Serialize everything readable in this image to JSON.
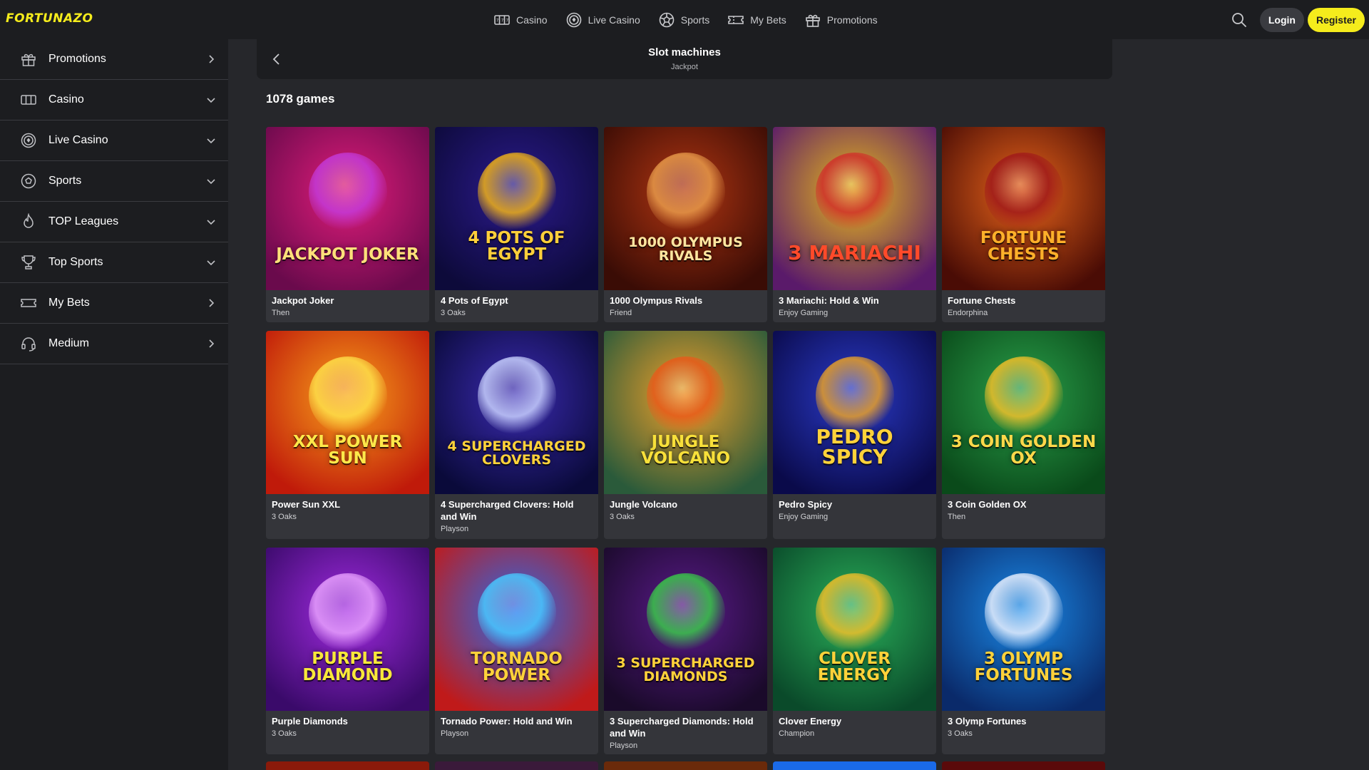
{
  "brand": {
    "logo": "FORTUNAZO",
    "accent": "#f5ec1c"
  },
  "topnav": [
    {
      "label": "Casino",
      "icon": "slot-machine-icon"
    },
    {
      "label": "Live Casino",
      "icon": "live-casino-chip-icon"
    },
    {
      "label": "Sports",
      "icon": "soccer-ball-icon"
    },
    {
      "label": "My Bets",
      "icon": "ticket-icon"
    },
    {
      "label": "Promotions",
      "icon": "gift-icon"
    }
  ],
  "actions": {
    "login": "Login",
    "register": "Register"
  },
  "sidebar": [
    {
      "label": "Promotions",
      "icon": "gift-icon",
      "chevron": "right"
    },
    {
      "label": "Casino",
      "icon": "slot-machine-icon",
      "chevron": "down"
    },
    {
      "label": "Live Casino",
      "icon": "live-casino-chip-icon",
      "chevron": "down"
    },
    {
      "label": "Sports",
      "icon": "soccer-ball-icon",
      "chevron": "down"
    },
    {
      "label": "TOP Leagues",
      "icon": "flame-icon",
      "chevron": "down"
    },
    {
      "label": "Top Sports",
      "icon": "trophy-icon",
      "chevron": "down"
    },
    {
      "label": "My Bets",
      "icon": "ticket-icon",
      "chevron": "right"
    },
    {
      "label": "Medium",
      "icon": "support-headset-icon",
      "chevron": "right"
    }
  ],
  "category": {
    "title": "Slot machines",
    "subtitle": "Jackpot"
  },
  "count": "1078 games",
  "games": [
    {
      "name": "Jackpot Joker",
      "provider": "Then",
      "art": "JACKPOT JOKER",
      "bg1": "#e01c7a",
      "bg2": "#6a0a4c",
      "orb": "#c43ad9",
      "txt": "#ffe07a"
    },
    {
      "name": "4 Pots of Egypt",
      "provider": "3 Oaks",
      "art": "4 POTS OF EGYPT",
      "bg1": "#2b1a8c",
      "bg2": "#0d0a3a",
      "orb": "#f0b21a",
      "txt": "#ffcf3a"
    },
    {
      "name": "1000 Olympus Rivals",
      "provider": "Friend",
      "art": "1000 OLYMPUS RIVALS",
      "bg1": "#b03512",
      "bg2": "#3a0c05",
      "orb": "#e89a4a",
      "txt": "#ffe6a0"
    },
    {
      "name": "3 Mariachi: Hold & Win",
      "provider": "Enjoy Gaming",
      "art": "3 MARIACHI",
      "bg1": "#e8b81a",
      "bg2": "#5a1a6a",
      "orb": "#d0302a",
      "txt": "#ff4a2a"
    },
    {
      "name": "Fortune Chests",
      "provider": "Endorphina",
      "art": "FORTUNE CHESTS",
      "bg1": "#e8641a",
      "bg2": "#4a0c05",
      "orb": "#a01a1a",
      "txt": "#ffb02a"
    },
    {
      "name": "Power Sun XXL",
      "provider": "3 Oaks",
      "art": "XXL POWER SUN",
      "bg1": "#f8a01a",
      "bg2": "#c01a0a",
      "orb": "#ffe04a",
      "txt": "#ffe84a"
    },
    {
      "name": "4 Supercharged Clovers: Hold and Win",
      "provider": "Playson",
      "art": "4 SUPERCHARGED CLOVERS",
      "bg1": "#3a2ab0",
      "bg2": "#0a0a3a",
      "orb": "#c8d0ff",
      "txt": "#ffd23a"
    },
    {
      "name": "Jungle Volcano",
      "provider": "3 Oaks",
      "art": "JUNGLE VOLCANO",
      "bg1": "#f0a02a",
      "bg2": "#2a5a3a",
      "orb": "#e85a1a",
      "txt": "#f8e03a"
    },
    {
      "name": "Pedro Spicy",
      "provider": "Enjoy Gaming",
      "art": "PEDRO SPICY",
      "bg1": "#2a3ac8",
      "bg2": "#0a0a4a",
      "orb": "#e8a02a",
      "txt": "#ffd23a"
    },
    {
      "name": "3 Coin Golden OX",
      "provider": "Then",
      "art": "3 COIN GOLDEN OX",
      "bg1": "#2aa04a",
      "bg2": "#0a4a1a",
      "orb": "#f0c02a",
      "txt": "#ffd84a"
    },
    {
      "name": "Purple Diamonds",
      "provider": "3 Oaks",
      "art": "PURPLE DIAMOND",
      "bg1": "#a02ae0",
      "bg2": "#3a0a6a",
      "orb": "#e8a0ff",
      "txt": "#f8e83a"
    },
    {
      "name": "Tornado Power: Hold and Win",
      "provider": "Playson",
      "art": "TORNADO POWER",
      "bg1": "#2a6ae8",
      "bg2": "#c01a1a",
      "orb": "#4ac8ff",
      "txt": "#ffd23a"
    },
    {
      "name": "3 Supercharged Diamonds: Hold and Win",
      "provider": "Playson",
      "art": "3 SUPERCHARGED DIAMONDS",
      "bg1": "#5a1a8a",
      "bg2": "#1a0a2a",
      "orb": "#3ac84a",
      "txt": "#ffd23a"
    },
    {
      "name": "Clover Energy",
      "provider": "Champion",
      "art": "CLOVER ENERGY",
      "bg1": "#2ab05a",
      "bg2": "#0a4a2a",
      "orb": "#f0c02a",
      "txt": "#ffd23a"
    },
    {
      "name": "3 Olymp Fortunes",
      "provider": "3 Oaks",
      "art": "3 OLYMP FORTUNES",
      "bg1": "#1a8ae8",
      "bg2": "#0a2a6a",
      "orb": "#e8f0ff",
      "txt": "#ffd23a"
    }
  ]
}
